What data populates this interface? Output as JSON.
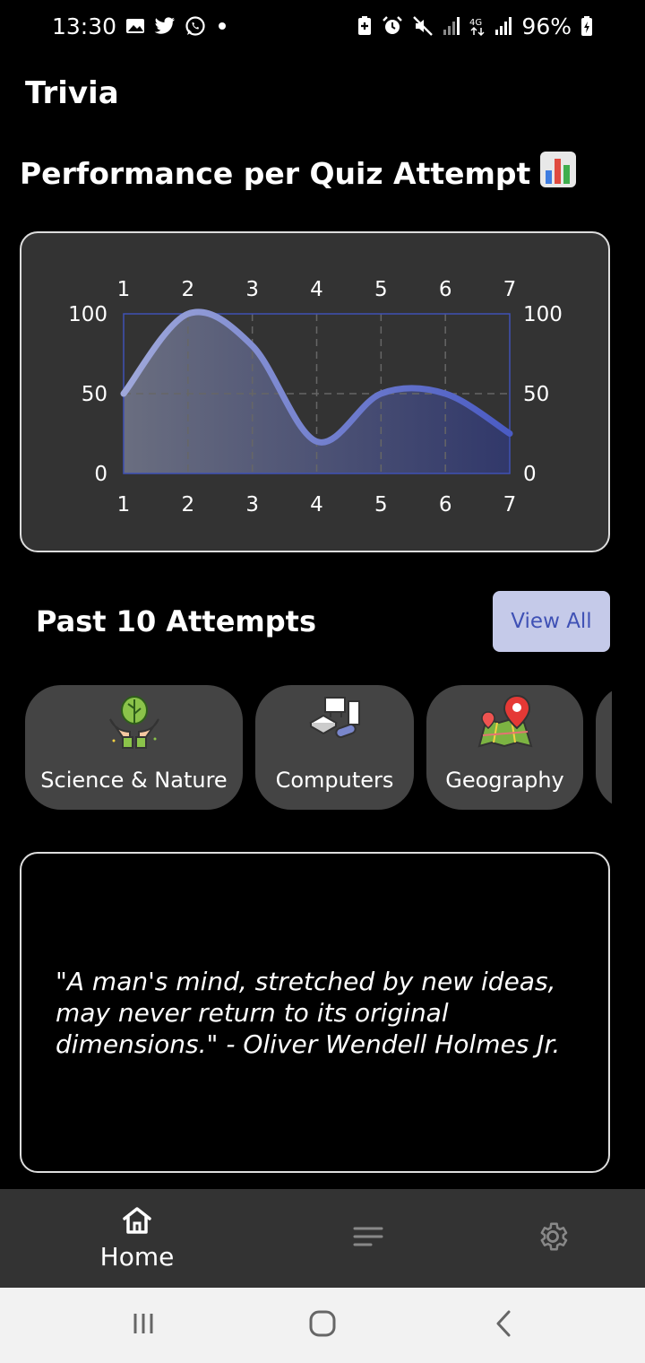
{
  "status_bar": {
    "time": "13:30",
    "battery": "96%",
    "left_icons": [
      "gallery-icon",
      "twitter-icon",
      "whatsapp-icon",
      "dot-icon"
    ],
    "right_icons": [
      "battery-saver-icon",
      "alarm-icon",
      "mute-icon",
      "signal-icon",
      "4g-icon",
      "signal-icon",
      "battery-charging-icon"
    ]
  },
  "app": {
    "title": "Trivia"
  },
  "performance": {
    "title": "Performance per Quiz Attempt",
    "emoji": "📊"
  },
  "chart_data": {
    "type": "area",
    "x": [
      1,
      2,
      3,
      4,
      5,
      6,
      7
    ],
    "series": [
      {
        "values": [
          50,
          100,
          80,
          20,
          50,
          50,
          25
        ]
      }
    ],
    "x_ticks": [
      "1",
      "2",
      "3",
      "4",
      "5",
      "6",
      "7"
    ],
    "y_ticks": [
      "0",
      "50",
      "100"
    ],
    "ylim": [
      0,
      100
    ],
    "xlim": [
      1,
      7
    ],
    "grid": true,
    "colors": {
      "line_start": "#9fa8da",
      "line_end": "#4a5bc4",
      "frame": "#3f51b5"
    }
  },
  "past_attempts": {
    "title": "Past 10 Attempts",
    "view_all_label": "View All",
    "items": [
      {
        "label": "Science & Nature",
        "icon": "plant-hands-icon"
      },
      {
        "label": "Computers",
        "icon": "computers-icon"
      },
      {
        "label": "Geography",
        "icon": "map-pin-icon"
      },
      {
        "label": "",
        "icon": ""
      }
    ]
  },
  "quote": {
    "text": "\"A man's mind, stretched by new ideas, may never return to its original dimensions.\" - Oliver Wendell Holmes Jr."
  },
  "bottom_nav": {
    "home_label": "Home",
    "items": [
      "home-icon",
      "list-icon",
      "gear-icon"
    ]
  },
  "system_nav": [
    "recents-icon",
    "home-button-icon",
    "back-icon"
  ]
}
